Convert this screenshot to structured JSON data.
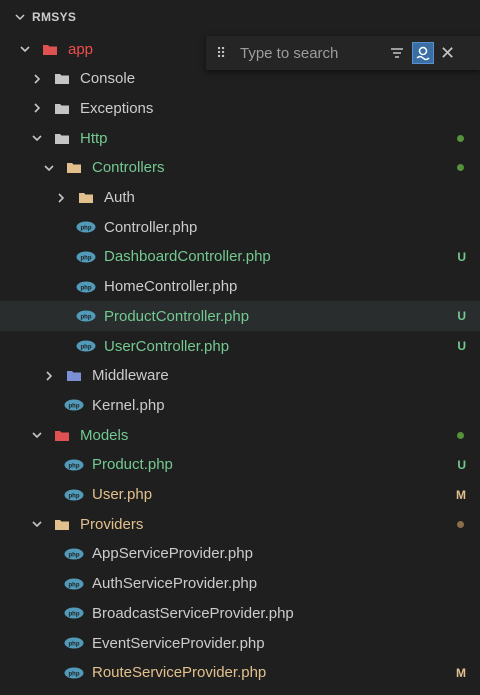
{
  "colors": {
    "default_text": "#cccccc",
    "untracked_text": "#73c991",
    "modified_text": "#e2c08d",
    "error_text": "#f14c4c",
    "folder_gray": "#c5c5c5",
    "folder_green": "#73c991",
    "folder_yellow": "#e2c08d",
    "php_icon": "#519aba",
    "dot_green": "#56913c",
    "dot_orange": "#8a6d4b"
  },
  "explorer": {
    "section_title": "RMSYS",
    "search": {
      "placeholder": "Type to search"
    },
    "rows": [
      {
        "label": "app",
        "expanded": true,
        "is_folder": true,
        "icon": "folder-app-icon",
        "color": "#f14c4c"
      },
      {
        "label": "Console",
        "expanded": false,
        "is_folder": true,
        "icon": "folder-icon",
        "color": "#cccccc"
      },
      {
        "label": "Exceptions",
        "expanded": false,
        "is_folder": true,
        "icon": "folder-icon",
        "color": "#cccccc"
      },
      {
        "label": "Http",
        "expanded": true,
        "is_folder": true,
        "icon": "folder-open-icon",
        "color": "#73c991",
        "dot": "green"
      },
      {
        "label": "Controllers",
        "expanded": true,
        "is_folder": true,
        "icon": "folder-controllers-icon",
        "color": "#73c991",
        "dot": "green"
      },
      {
        "label": "Auth",
        "expanded": false,
        "is_folder": true,
        "icon": "folder-auth-icon",
        "color": "#cccccc"
      },
      {
        "label": "Controller.php",
        "is_folder": false,
        "icon": "php-file-icon",
        "color": "#cccccc"
      },
      {
        "label": "DashboardController.php",
        "is_folder": false,
        "icon": "php-file-icon",
        "color": "#73c991",
        "status": "U"
      },
      {
        "label": "HomeController.php",
        "is_folder": false,
        "icon": "php-file-icon",
        "color": "#cccccc"
      },
      {
        "label": "ProductController.php",
        "is_folder": false,
        "icon": "php-file-icon",
        "color": "#73c991",
        "status": "U",
        "hover": true
      },
      {
        "label": "UserController.php",
        "is_folder": false,
        "icon": "php-file-icon",
        "color": "#73c991",
        "status": "U"
      },
      {
        "label": "Middleware",
        "expanded": false,
        "is_folder": true,
        "icon": "folder-middleware-icon",
        "color": "#cccccc"
      },
      {
        "label": "Kernel.php",
        "is_folder": false,
        "icon": "php-file-icon",
        "color": "#cccccc"
      },
      {
        "label": "Models",
        "expanded": true,
        "is_folder": true,
        "icon": "folder-models-icon",
        "color": "#73c991",
        "dot": "green"
      },
      {
        "label": "Product.php",
        "is_folder": false,
        "icon": "php-file-icon",
        "color": "#73c991",
        "status": "U"
      },
      {
        "label": "User.php",
        "is_folder": false,
        "icon": "php-file-icon",
        "color": "#e2c08d",
        "status": "M"
      },
      {
        "label": "Providers",
        "expanded": true,
        "is_folder": true,
        "icon": "folder-providers-icon",
        "color": "#e2c08d",
        "dot": "orange"
      },
      {
        "label": "AppServiceProvider.php",
        "is_folder": false,
        "icon": "php-file-icon",
        "color": "#cccccc"
      },
      {
        "label": "AuthServiceProvider.php",
        "is_folder": false,
        "icon": "php-file-icon",
        "color": "#cccccc"
      },
      {
        "label": "BroadcastServiceProvider.php",
        "is_folder": false,
        "icon": "php-file-icon",
        "color": "#cccccc"
      },
      {
        "label": "EventServiceProvider.php",
        "is_folder": false,
        "icon": "php-file-icon",
        "color": "#cccccc"
      },
      {
        "label": "RouteServiceProvider.php",
        "is_folder": false,
        "icon": "php-file-icon",
        "color": "#e2c08d",
        "status": "M"
      }
    ]
  }
}
